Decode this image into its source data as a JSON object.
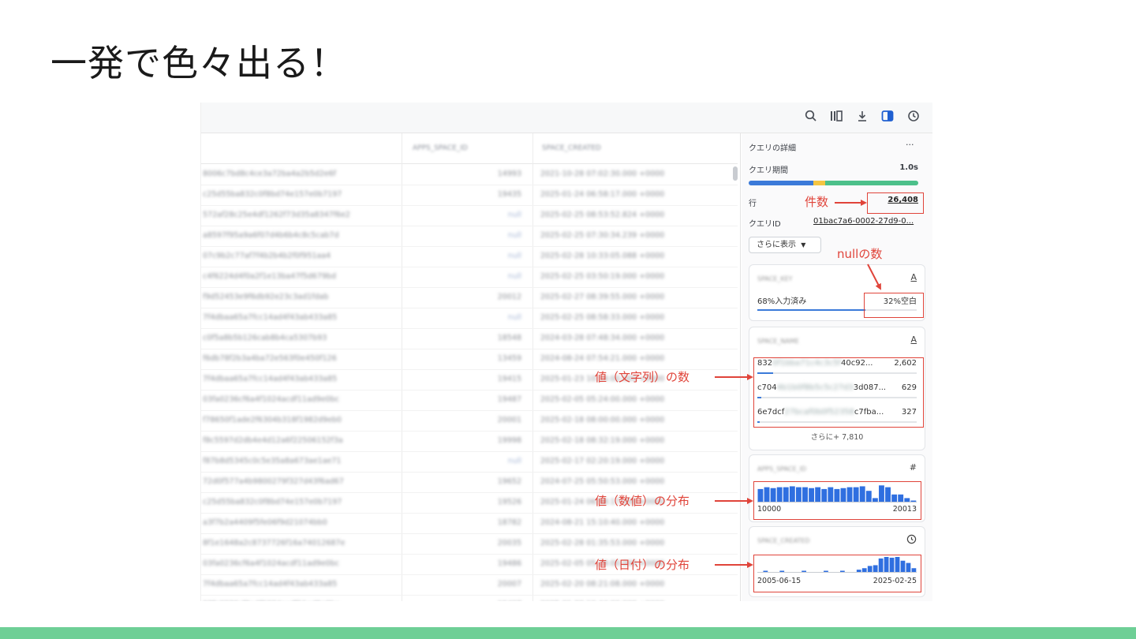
{
  "slide": {
    "title": "一発で色々出る！"
  },
  "toolbar": {
    "icons": [
      "search-icon",
      "columns-icon",
      "download-icon",
      "panel-toggle-icon",
      "history-icon"
    ]
  },
  "table": {
    "headers": [
      "APPS_SPACE_ID",
      "SPACE_CREATED"
    ],
    "rows": [
      {
        "c1": "8006c7bd8c4ce3a72ba4a2b5d2e6f",
        "c2": "14993",
        "c3": "2021-10-28 07:02:30.000 +0000"
      },
      {
        "c1": "c25d55ba832c0f8bd74e157e0b7197",
        "c2": "19435",
        "c3": "2025-01-24 06:58:17.000 +0000"
      },
      {
        "c1": "572af28c25e4df1262f73d35a8347f6e2",
        "c2": "null",
        "c3": "2025-02-25 08:53:52.824 +0000"
      },
      {
        "c1": "a8597f95a9a6f07d4b6b4c8c5cab7d",
        "c2": "null",
        "c3": "2025-02-25 07:30:34.239 +0000"
      },
      {
        "c1": "07c9b2c77af7f4b2b4b2f0f951aa4",
        "c2": "null",
        "c3": "2025-02-28 10:33:05.088 +0000"
      },
      {
        "c1": "c4f6224d4f0a2f1e13ba47f5d679bd",
        "c2": "null",
        "c3": "2025-02-25 03:50:19.000 +0000"
      },
      {
        "c1": "f9d52453e9f6db92e23c3ad1fdab",
        "c2": "20012",
        "c3": "2025-02-27 08:39:55.000 +0000"
      },
      {
        "c1": "7f4dbaa65a7fcc14ad4f43ab433a85",
        "c2": "null",
        "c3": "2025-02-25 08:58:33.000 +0000"
      },
      {
        "c1": "c0f5a8b5b126cab8b4ca5307b93",
        "c2": "18548",
        "c3": "2024-03-28 07:48:34.000 +0000"
      },
      {
        "c1": "f6db78f2b3a4ba72e563f0e450f126",
        "c2": "13459",
        "c3": "2024-08-24 07:54:21.000 +0000"
      },
      {
        "c1": "7f4dbaa65a7fcc14ad4f43ab433a85",
        "c2": "19415",
        "c3": "2025-01-23 10:14:00.000 +0000"
      },
      {
        "c1": "03fa0236cf6a4f1024acdf11ad9e0bc",
        "c2": "19487",
        "c3": "2025-02-05 05:24:00.000 +0000"
      },
      {
        "c1": "f78650f1ade2f6304b318f1982d9eb0",
        "c2": "20001",
        "c3": "2025-02-18 08:00:00.000 +0000"
      },
      {
        "c1": "f8c5597d2db4e4d12a6f22506152f3a",
        "c2": "19998",
        "c3": "2025-02-18 08:32:19.000 +0000"
      },
      {
        "c1": "f87b8d5345c0c5e35a8a673ae1ae71",
        "c2": "null",
        "c3": "2025-02-17 02:20:19.000 +0000"
      },
      {
        "c1": "72d0f577a4b9800279f327d43f6ad67",
        "c2": "19652",
        "c3": "2024-07-25 05:50:53.000 +0000"
      },
      {
        "c1": "c25d55ba832c0f8bd74e157e0b7197",
        "c2": "19526",
        "c3": "2025-01-24 06:58:17.000 +0000"
      },
      {
        "c1": "a3f7b2a4409f5fe06f9d21074bb0",
        "c2": "18782",
        "c3": "2024-08-21 15:10:40.000 +0000"
      },
      {
        "c1": "8f1e1648a2c8737726f16a74012687e",
        "c2": "20035",
        "c3": "2025-02-28 01:35:53.000 +0000"
      },
      {
        "c1": "03fa0236cf6a4f1024acdf11ad9e0bc",
        "c2": "19486",
        "c3": "2025-02-05 05:24:00.000 +0000"
      },
      {
        "c1": "7f4dbaa65a7fcc14ad4f43ab433a85",
        "c2": "20007",
        "c3": "2025-02-20 08:21:08.000 +0000"
      },
      {
        "c1": "03fa0236cf6a4f1024acdf11ad9e0bc",
        "c2": "19427",
        "c3": "2025-01-23 10:44:00.000 +0000"
      }
    ]
  },
  "panel": {
    "title": "クエリの詳細",
    "menu_label": "···",
    "duration_label": "クエリ期間",
    "duration_value": "1.0s",
    "duration_segments": [
      {
        "fraction": 0.38,
        "color": "#3b7ad9"
      },
      {
        "fraction": 0.07,
        "color": "#f4c542"
      },
      {
        "fraction": 0.55,
        "color": "#4cc08a"
      }
    ],
    "rows_label": "行",
    "rows_value": "26,408",
    "query_id_label": "クエリID",
    "query_id_value": "01bac7a6-0002-27d9-0...",
    "show_more": "さらに表示",
    "cards": [
      {
        "name": "SPACE_KEY",
        "type_icon": "A",
        "filled_label": "68%入力済み",
        "empty_label": "32%空白",
        "filled_fraction": 0.68
      },
      {
        "name": "SPACE_NAME",
        "type_icon": "A",
        "values": [
          {
            "prefix": "832",
            "hidden": "0f1bba71c4c3c5f",
            "suffix": "40c92...",
            "count": "2,602",
            "fraction": 0.1
          },
          {
            "prefix": "c704",
            "hidden": "4b1b0f8b5c5c27d3",
            "suffix": "3d087...",
            "count": "629",
            "fraction": 0.025
          },
          {
            "prefix": "6e7dcf",
            "hidden": "27bcaf0b0f52358",
            "suffix": "c7fba...",
            "count": "327",
            "fraction": 0.013
          }
        ],
        "more": "さらに+ 7,810"
      },
      {
        "name": "APPS_SPACE_ID",
        "type_icon": "#",
        "min": "10000",
        "max": "20013",
        "histogram": [
          0.7,
          0.8,
          0.75,
          0.8,
          0.8,
          0.85,
          0.8,
          0.8,
          0.75,
          0.8,
          0.7,
          0.8,
          0.7,
          0.75,
          0.8,
          0.8,
          0.85,
          0.6,
          0.2,
          0.9,
          0.8,
          0.4,
          0.4,
          0.2,
          0.05
        ]
      },
      {
        "name": "SPACE_CREATED",
        "type_icon": "clock-icon",
        "min": "2005-06-15",
        "max": "2025-02-25",
        "histogram": [
          0,
          0.08,
          0,
          0,
          0.08,
          0,
          0,
          0,
          0.08,
          0,
          0,
          0,
          0.05,
          0,
          0,
          0.08,
          0,
          0,
          0.15,
          0.25,
          0.4,
          0.45,
          0.9,
          1.0,
          0.95,
          1.0,
          0.75,
          0.6,
          0.25
        ]
      }
    ]
  },
  "annotations": {
    "row_count": "件数",
    "null_count": "nullの数",
    "value_count": "値（文字列）の数",
    "numeric_dist": "値（数値）の分布",
    "date_dist": "値（日付）の分布",
    "color": "#e0443a"
  }
}
